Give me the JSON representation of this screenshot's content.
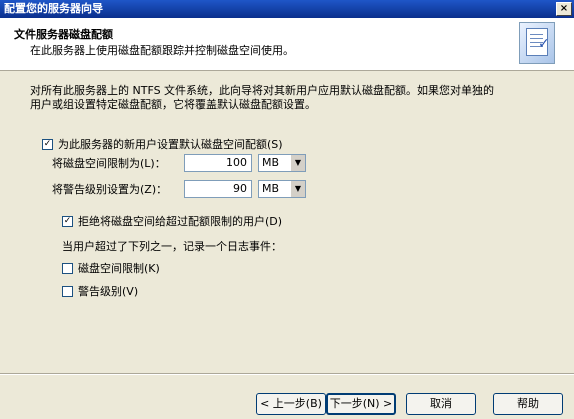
{
  "window": {
    "title": "配置您的服务器向导",
    "close_glyph": "×"
  },
  "header": {
    "title": "文件服务器磁盘配额",
    "subtitle": "在此服务器上使用磁盘配额跟踪并控制磁盘空间使用。"
  },
  "description": {
    "line1": "对所有此服务器上的 NTFS 文件系统，此向导将对其新用户应用默认磁盘配额。如果您对单独的",
    "line2": "用户或组设置特定磁盘配额，它将覆盖默认磁盘配额设置。"
  },
  "quota": {
    "enable_label": "为此服务器的新用户设置默认磁盘空间配额(S)",
    "enable_checked": true,
    "limit_label": "将磁盘空间限制为(L)：",
    "limit_value": "100",
    "limit_unit": "MB",
    "warn_label": "将警告级别设置为(Z)：",
    "warn_value": "90",
    "warn_unit": "MB",
    "deny_label": "拒绝将磁盘空间给超过配额限制的用户(D)",
    "deny_checked": true
  },
  "logging": {
    "label": "当用户超过了下列之一，记录一个日志事件：",
    "limit_label": "磁盘空间限制(K)",
    "limit_checked": false,
    "warn_label": "警告级别(V)",
    "warn_checked": false
  },
  "buttons": {
    "back": "< 上一步(B)",
    "next": "下一步(N) >",
    "cancel": "取消",
    "help": "帮助"
  },
  "check_glyph": "✓",
  "dropdown_glyph": "▼"
}
